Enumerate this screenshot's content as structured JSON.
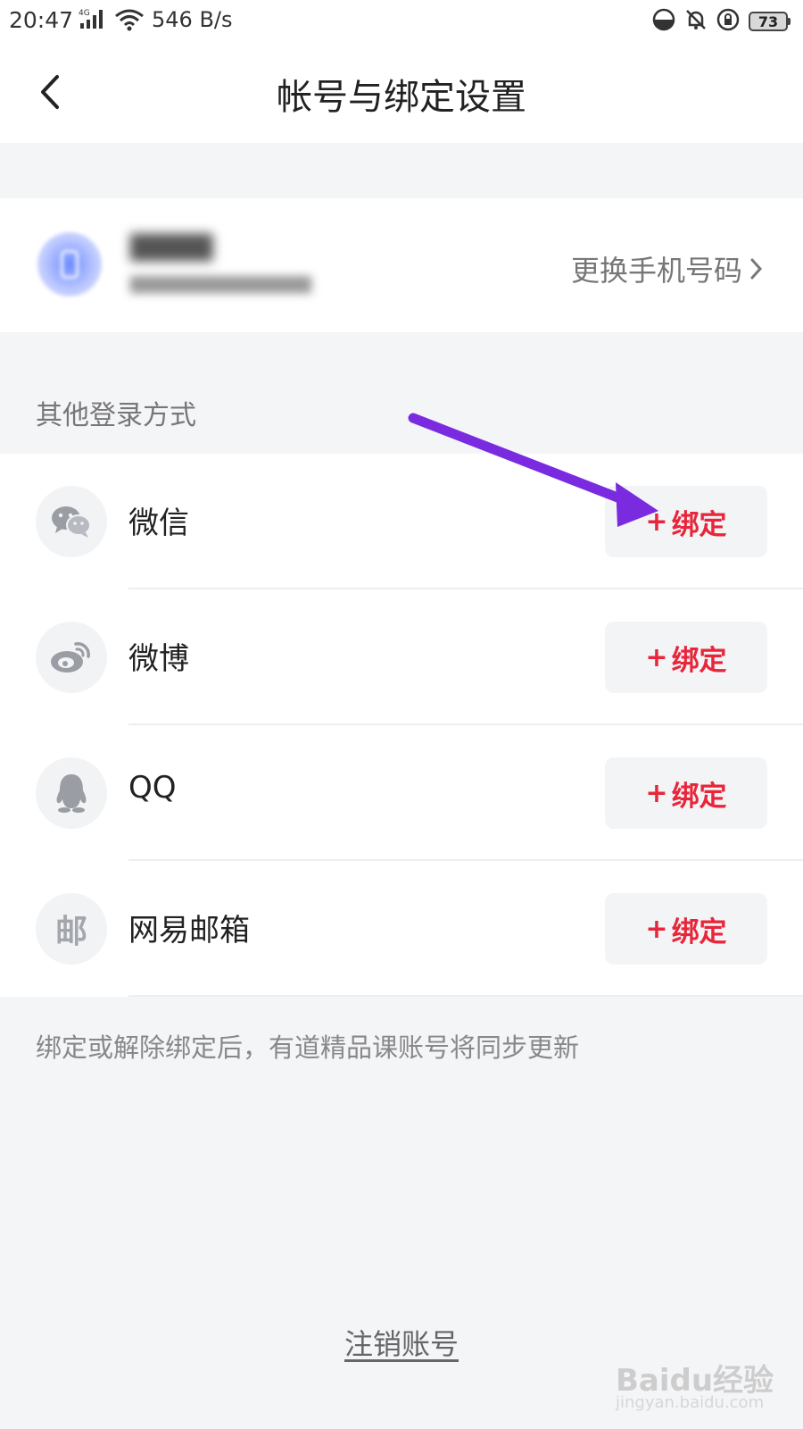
{
  "status_bar": {
    "time": "20:47",
    "network": "4G",
    "data_rate": "546 B/s",
    "battery": "73"
  },
  "nav": {
    "title": "帐号与绑定设置"
  },
  "profile": {
    "change_phone_label": "更换手机号码"
  },
  "other_login": {
    "section_label": "其他登录方式",
    "items": [
      {
        "label": "微信",
        "icon": "wechat-icon",
        "bind_label": "绑定"
      },
      {
        "label": "微博",
        "icon": "weibo-icon",
        "bind_label": "绑定"
      },
      {
        "label": "QQ",
        "icon": "qq-icon",
        "bind_label": "绑定"
      },
      {
        "label": "网易邮箱",
        "icon": "mail-icon",
        "icon_text": "邮",
        "bind_label": "绑定"
      }
    ]
  },
  "note": "绑定或解除绑定后，有道精品课账号将同步更新",
  "cancel_account_label": "注销账号",
  "watermark": {
    "brand": "Baidu经验",
    "url": "jingyan.baidu.com"
  },
  "colors": {
    "bind_red": "#e8263b",
    "annotation_arrow": "#7a2be0"
  }
}
